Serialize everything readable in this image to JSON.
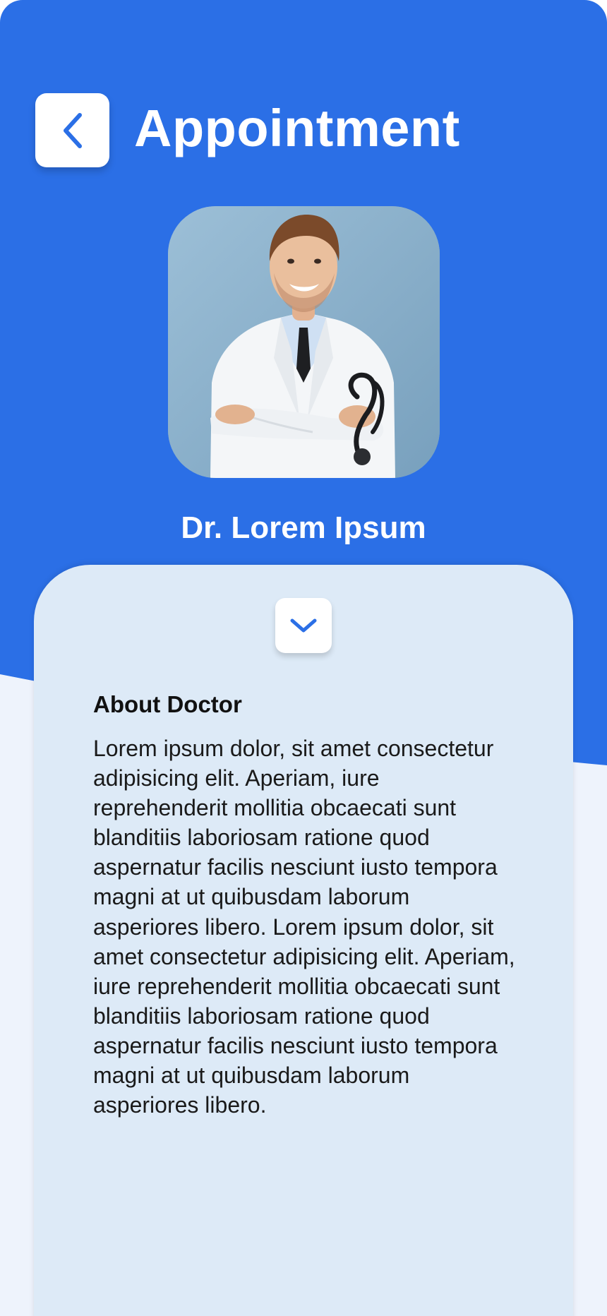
{
  "colors": {
    "header_blue": "#2b6fe6",
    "page_background": "#eef3fc",
    "card_background": "#ddeaf7",
    "button_background": "#ffffff",
    "icon_blue": "#2b6fe6"
  },
  "header": {
    "title": "Appointment",
    "back_icon": "chevron-left-icon"
  },
  "doctor": {
    "name": "Dr. Lorem Ipsum",
    "photo": "doctor-portrait"
  },
  "card": {
    "collapse_icon": "chevron-down-icon",
    "about_title": "About Doctor",
    "about_text": "Lorem ipsum dolor, sit amet consectetur adipisicing elit. Aperiam, iure reprehenderit mollitia obcaecati sunt blanditiis laboriosam ratione quod aspernatur facilis nesciunt iusto tempora magni at ut quibusdam laborum asperiores libero. Lorem ipsum dolor, sit amet consectetur adipisicing elit. Aperiam, iure reprehenderit mollitia obcaecati sunt blanditiis laboriosam ratione quod aspernatur facilis nesciunt iusto tempora magni at ut quibusdam laborum asperiores libero."
  }
}
